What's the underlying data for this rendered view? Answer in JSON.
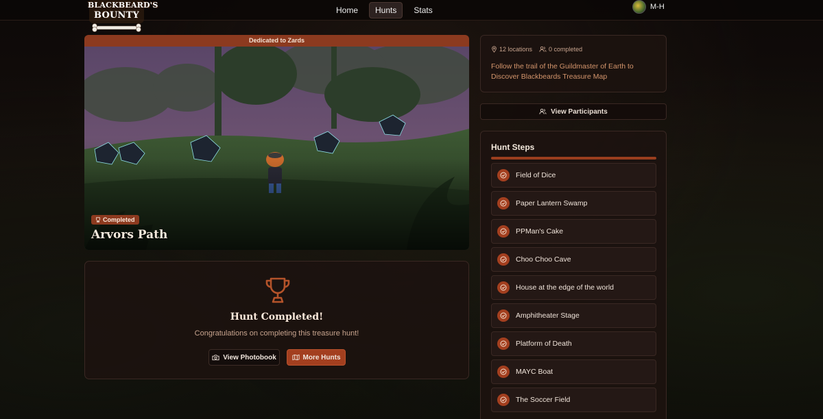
{
  "app": {
    "logo_line1": "BLACKBEARD'S",
    "logo_line2": "BOUNTY"
  },
  "nav": {
    "items": [
      {
        "label": "Home",
        "active": false
      },
      {
        "label": "Hunts",
        "active": true
      },
      {
        "label": "Stats",
        "active": false
      }
    ]
  },
  "user": {
    "name": "M-H"
  },
  "hunt": {
    "dedication": "Dedicated to Zards",
    "status_badge": "Completed",
    "title": "Arvors Path",
    "locations": "12 locations",
    "completed_count": "0 completed",
    "description": "Follow the trail of the Guildmaster of Earth to Discover Blackbeards Treasure Map"
  },
  "completion": {
    "title": "Hunt Completed!",
    "subtitle": "Congratulations on completing this treasure hunt!",
    "photobook_label": "View Photobook",
    "more_hunts_label": "More Hunts"
  },
  "participants_button": "View Participants",
  "steps": {
    "title": "Hunt Steps",
    "items": [
      {
        "label": "Field of Dice"
      },
      {
        "label": "Paper Lantern Swamp"
      },
      {
        "label": "PPMan's Cake"
      },
      {
        "label": "Choo Choo Cave"
      },
      {
        "label": "House at the edge of the world"
      },
      {
        "label": "Amphitheater Stage"
      },
      {
        "label": "Platform of Death"
      },
      {
        "label": "MAYC Boat"
      },
      {
        "label": "The Soccer Field"
      }
    ]
  },
  "colors": {
    "accent": "#a33f1f",
    "accent_text": "#d4956c",
    "card_bg": "#1c120f"
  }
}
